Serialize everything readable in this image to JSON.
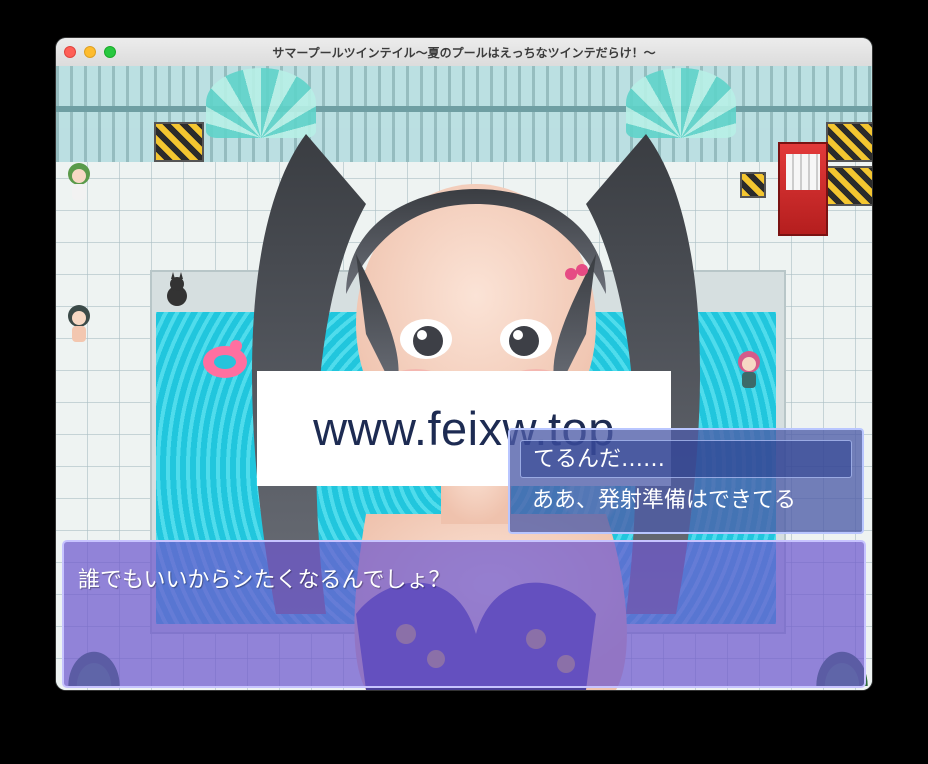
{
  "window": {
    "title": "サマープールツインテイル〜夏のプールはえっちなツインテだらけ！〜"
  },
  "watermark": {
    "text": "www.feixw.top"
  },
  "choices": {
    "items": [
      {
        "label": "てるんだ……"
      },
      {
        "label": "ああ、発射準備はできてる"
      }
    ]
  },
  "message": {
    "text": "誰でもいいからシたくなるんでしょ？"
  },
  "colors": {
    "message_bg": "#6e58cd",
    "choice_bg": "#4e5ca8",
    "pool": "#21c6dd"
  },
  "icons": [
    "close-icon",
    "minimize-icon",
    "maximize-icon"
  ]
}
